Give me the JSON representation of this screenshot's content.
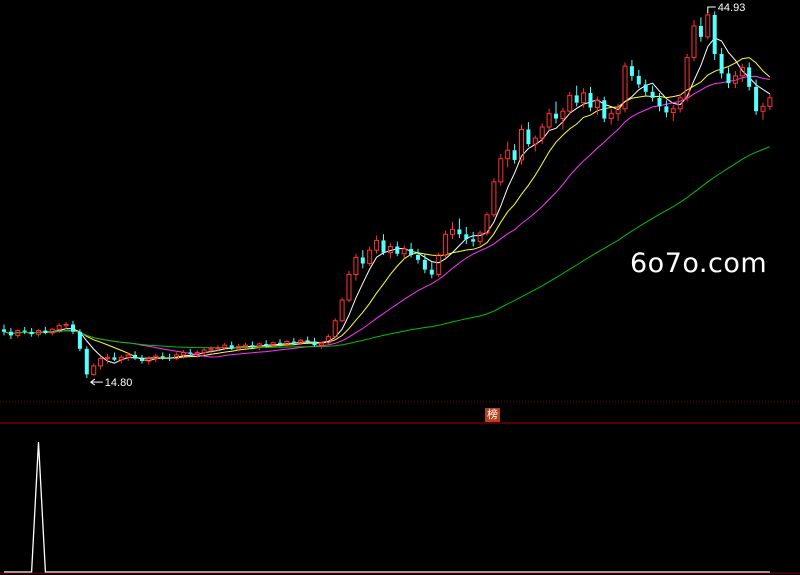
{
  "watermark": "6o7o.com",
  "marker_label": "榜",
  "colors": {
    "background": "#000000",
    "up_candle": "#ff3232",
    "down_candle": "#54ffff",
    "ma5": "#ffffff",
    "ma10": "#ffff33",
    "ma20": "#ff33ff",
    "ma60": "#00c000",
    "grid": "#800000",
    "indicator": "#ffffff"
  },
  "chart_data": {
    "type": "candlestick",
    "price_range": [
      13.0,
      45.5
    ],
    "annotations": {
      "high": "44.93",
      "low": "14.80"
    },
    "ohlc": [
      [
        18.8,
        19.2,
        18.3,
        18.6
      ],
      [
        18.6,
        18.9,
        18.0,
        18.3
      ],
      [
        18.3,
        18.8,
        18.1,
        18.7
      ],
      [
        18.7,
        19.0,
        18.4,
        18.6
      ],
      [
        18.6,
        18.9,
        18.2,
        18.4
      ],
      [
        18.4,
        18.8,
        18.2,
        18.7
      ],
      [
        18.7,
        19.0,
        18.4,
        18.5
      ],
      [
        18.5,
        18.9,
        18.3,
        18.8
      ],
      [
        18.8,
        19.3,
        18.5,
        19.1
      ],
      [
        19.1,
        19.4,
        18.8,
        19.2
      ],
      [
        19.2,
        19.5,
        18.4,
        18.6
      ],
      [
        18.6,
        18.8,
        17.0,
        17.2
      ],
      [
        17.2,
        17.4,
        14.8,
        15.1
      ],
      [
        15.1,
        16.0,
        15.0,
        15.8
      ],
      [
        15.8,
        16.6,
        15.5,
        16.4
      ],
      [
        16.4,
        16.8,
        16.0,
        16.5
      ],
      [
        16.5,
        16.9,
        16.2,
        16.3
      ],
      [
        16.3,
        16.7,
        16.0,
        16.5
      ],
      [
        16.5,
        16.9,
        16.2,
        16.7
      ],
      [
        16.7,
        17.0,
        16.3,
        16.4
      ],
      [
        16.4,
        16.7,
        16.0,
        16.2
      ],
      [
        16.2,
        16.6,
        15.9,
        16.4
      ],
      [
        16.4,
        16.8,
        16.1,
        16.6
      ],
      [
        16.6,
        16.9,
        16.3,
        16.5
      ],
      [
        16.5,
        16.8,
        16.2,
        16.4
      ],
      [
        16.4,
        16.9,
        16.3,
        16.7
      ],
      [
        16.7,
        17.1,
        16.4,
        16.9
      ],
      [
        16.9,
        17.2,
        16.6,
        16.8
      ],
      [
        16.8,
        17.1,
        16.5,
        16.9
      ],
      [
        16.9,
        17.3,
        16.7,
        17.1
      ],
      [
        17.1,
        17.4,
        16.8,
        17.2
      ],
      [
        17.2,
        17.5,
        17.0,
        17.3
      ],
      [
        17.3,
        17.7,
        17.1,
        17.5
      ],
      [
        17.5,
        17.8,
        17.1,
        17.2
      ],
      [
        17.2,
        17.6,
        17.0,
        17.4
      ],
      [
        17.4,
        17.7,
        17.2,
        17.5
      ],
      [
        17.5,
        17.8,
        17.2,
        17.4
      ],
      [
        17.4,
        17.7,
        17.1,
        17.6
      ],
      [
        17.6,
        17.9,
        17.3,
        17.5
      ],
      [
        17.5,
        17.8,
        17.3,
        17.7
      ],
      [
        17.7,
        18.0,
        17.4,
        17.6
      ],
      [
        17.6,
        17.9,
        17.4,
        17.8
      ],
      [
        17.8,
        18.1,
        17.5,
        17.7
      ],
      [
        17.7,
        18.0,
        17.5,
        17.9
      ],
      [
        17.9,
        18.2,
        17.6,
        17.8
      ],
      [
        17.8,
        18.1,
        17.4,
        17.5
      ],
      [
        17.5,
        17.8,
        17.2,
        17.7
      ],
      [
        17.7,
        18.4,
        17.6,
        18.2
      ],
      [
        18.2,
        19.7,
        18.1,
        19.5
      ],
      [
        19.5,
        21.4,
        19.4,
        21.2
      ],
      [
        21.2,
        23.6,
        21.0,
        23.3
      ],
      [
        23.3,
        25.0,
        22.8,
        24.7
      ],
      [
        24.7,
        25.3,
        23.8,
        24.2
      ],
      [
        24.2,
        25.6,
        24.0,
        25.3
      ],
      [
        25.3,
        26.5,
        25.0,
        26.1
      ],
      [
        26.1,
        26.6,
        24.9,
        25.1
      ],
      [
        25.1,
        25.9,
        24.6,
        25.6
      ],
      [
        25.6,
        26.0,
        24.8,
        25.0
      ],
      [
        25.0,
        25.7,
        24.6,
        25.4
      ],
      [
        25.4,
        25.9,
        24.7,
        24.9
      ],
      [
        24.9,
        25.4,
        24.2,
        24.5
      ],
      [
        24.5,
        25.0,
        23.4,
        23.7
      ],
      [
        23.7,
        24.3,
        23.0,
        23.3
      ],
      [
        23.3,
        25.1,
        23.1,
        24.9
      ],
      [
        24.9,
        26.9,
        24.7,
        26.6
      ],
      [
        26.6,
        27.6,
        26.2,
        27.0
      ],
      [
        27.0,
        27.9,
        26.3,
        26.6
      ],
      [
        26.6,
        27.2,
        25.8,
        26.2
      ],
      [
        26.2,
        26.8,
        25.6,
        26.0
      ],
      [
        26.0,
        26.9,
        25.7,
        26.7
      ],
      [
        26.7,
        28.4,
        26.5,
        28.2
      ],
      [
        28.2,
        31.2,
        28.0,
        30.9
      ],
      [
        30.9,
        33.2,
        30.6,
        32.8
      ],
      [
        32.8,
        34.2,
        32.1,
        33.5
      ],
      [
        33.5,
        34.0,
        32.4,
        32.7
      ],
      [
        32.7,
        35.6,
        32.3,
        35.2
      ],
      [
        35.2,
        35.8,
        33.8,
        34.0
      ],
      [
        34.0,
        34.7,
        33.4,
        34.5
      ],
      [
        34.5,
        35.7,
        34.0,
        35.4
      ],
      [
        35.4,
        36.9,
        35.1,
        36.5
      ],
      [
        36.5,
        37.5,
        35.7,
        36.1
      ],
      [
        36.1,
        37.0,
        35.2,
        36.7
      ],
      [
        36.7,
        38.3,
        36.4,
        38.0
      ],
      [
        38.0,
        38.8,
        37.1,
        37.4
      ],
      [
        37.4,
        38.6,
        37.0,
        38.2
      ],
      [
        38.2,
        38.7,
        36.7,
        37.0
      ],
      [
        37.0,
        37.9,
        36.4,
        37.6
      ],
      [
        37.6,
        37.9,
        35.8,
        36.1
      ],
      [
        36.1,
        36.9,
        35.6,
        36.5
      ],
      [
        36.5,
        37.3,
        35.9,
        36.9
      ],
      [
        36.9,
        40.7,
        36.6,
        40.4
      ],
      [
        40.4,
        40.9,
        39.2,
        39.6
      ],
      [
        39.6,
        40.1,
        38.6,
        38.9
      ],
      [
        38.9,
        39.3,
        37.9,
        38.3
      ],
      [
        38.3,
        38.8,
        37.5,
        37.8
      ],
      [
        37.8,
        38.2,
        36.7,
        37.1
      ],
      [
        37.1,
        37.6,
        36.2,
        36.6
      ],
      [
        36.6,
        37.2,
        35.9,
        36.9
      ],
      [
        36.9,
        38.1,
        36.6,
        37.8
      ],
      [
        37.8,
        41.4,
        37.5,
        41.1
      ],
      [
        41.1,
        44.2,
        40.8,
        43.7
      ],
      [
        43.7,
        44.4,
        42.4,
        42.8
      ],
      [
        42.8,
        44.93,
        42.6,
        44.6
      ],
      [
        44.6,
        44.9,
        40.9,
        41.4
      ],
      [
        41.4,
        41.9,
        39.4,
        39.8
      ],
      [
        39.8,
        40.3,
        38.6,
        39.0
      ],
      [
        39.0,
        40.0,
        38.6,
        39.6
      ],
      [
        39.6,
        40.6,
        39.1,
        40.3
      ],
      [
        40.3,
        40.7,
        38.4,
        38.7
      ],
      [
        38.7,
        39.3,
        36.4,
        36.7
      ],
      [
        36.7,
        37.4,
        36.0,
        37.1
      ],
      [
        37.1,
        38.1,
        36.8,
        37.8
      ]
    ],
    "ma": [
      {
        "period": 5
      },
      {
        "period": 10
      },
      {
        "period": 20
      },
      {
        "period": 60
      }
    ],
    "indicator": {
      "spike_index": 5,
      "spike_value": 1
    }
  }
}
